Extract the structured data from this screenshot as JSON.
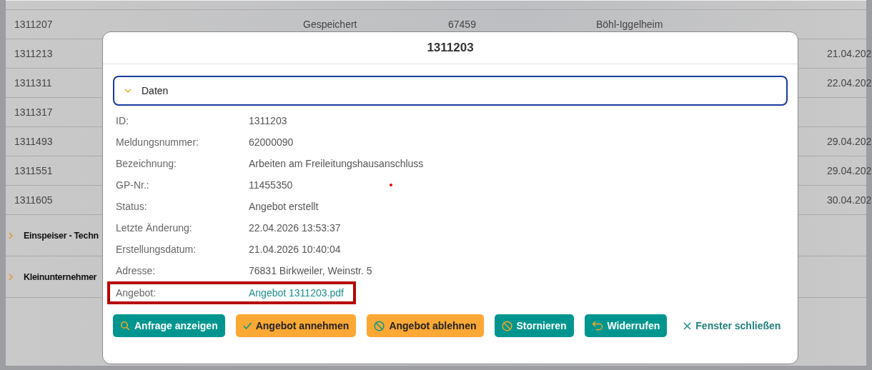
{
  "table": {
    "rows": [
      {
        "column_1": "1311207",
        "column_2": "Gespeichert",
        "column_3": "67459",
        "column_4": "Böhl-Iggelheim"
      },
      {
        "column_1": "1311213",
        "column_5": "21.04.202"
      },
      {
        "column_1": "1311311",
        "column_5": "22.04.202"
      },
      {
        "column_1": "1311317"
      },
      {
        "column_1": "1311493",
        "column_5": "29.04.202"
      },
      {
        "column_1": "1311551",
        "column_5": "29.04.202"
      },
      {
        "column_1": "1311605",
        "column_5": "30.04.202"
      }
    ]
  },
  "groups": [
    {
      "label": "Einspeiser - Techn",
      "expanded": false
    },
    {
      "label": "Kleinunternehmer",
      "expanded": false
    }
  ],
  "dialog": {
    "title": "1311203",
    "section": {
      "label": "Daten",
      "expanded": true
    },
    "fields": [
      {
        "label": "ID:",
        "value": "1311203",
        "kind": "text"
      },
      {
        "label": "Meldungsnummer:",
        "value": "62000090",
        "kind": "text"
      },
      {
        "label": "Bezeichnung:",
        "value": "Arbeiten am Freileitungshausanschluss",
        "kind": "text"
      },
      {
        "label": "GP-Nr.:",
        "value": "11455350",
        "kind": "text"
      },
      {
        "label": "Status:",
        "value": "Angebot erstellt",
        "kind": "text"
      },
      {
        "label": "Letzte Änderung:",
        "value": "22.04.2026 13:53:37",
        "kind": "text"
      },
      {
        "label": "Erstellungsdatum:",
        "value": "21.04.2026 10:40:04",
        "kind": "text"
      },
      {
        "label": "Adresse:",
        "value": "76831 Birkweiler, Weinstr. 5",
        "kind": "text"
      },
      {
        "label": "Angebot:",
        "value": "Angebot 1311203.pdf",
        "kind": "link",
        "highlighted": true
      }
    ],
    "buttons": [
      {
        "label": "Anfrage anzeigen",
        "kind": "primary"
      },
      {
        "label": "Angebot annehmen",
        "kind": "warning"
      },
      {
        "label": "Angebot ablehnen",
        "kind": "warning"
      },
      {
        "label": "Stornieren",
        "kind": "primary"
      },
      {
        "label": "Widerrufen",
        "kind": "primary"
      },
      {
        "label": "Fenster schließen",
        "kind": "plain"
      }
    ]
  }
}
